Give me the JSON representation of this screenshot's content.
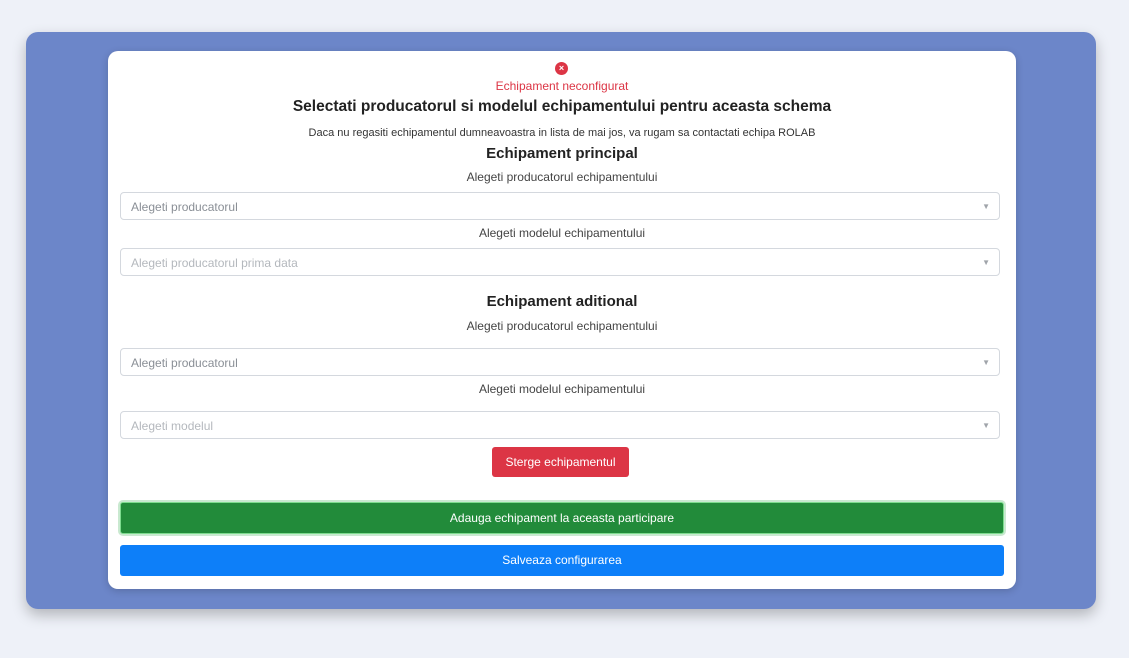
{
  "status": {
    "icon": "error-x-icon",
    "icon_glyph": "×",
    "text": "Echipament neconfigurat",
    "color": "#dc3545"
  },
  "header": {
    "title": "Selectati producatorul si modelul echipamentului pentru aceasta schema",
    "note": "Daca nu regasiti echipamentul dumneavoastra in lista de mai jos, va rugam sa contactati echipa ROLAB"
  },
  "principal": {
    "title": "Echipament principal",
    "producer_label": "Alegeti producatorul echipamentului",
    "producer_placeholder": "Alegeti producatorul",
    "model_label": "Alegeti modelul echipamentului",
    "model_placeholder": "Alegeti producatorul prima data"
  },
  "aditional": {
    "title": "Echipament aditional",
    "producer_label": "Alegeti producatorul echipamentului",
    "producer_placeholder": "Alegeti producatorul",
    "model_label": "Alegeti modelul echipamentului",
    "model_placeholder": "Alegeti modelul"
  },
  "actions": {
    "delete_label": "Sterge echipamentul",
    "add_label": "Adauga echipament la aceasta participare",
    "save_label": "Salveaza configurarea"
  },
  "colors": {
    "outer_panel": "#6c86c9",
    "danger": "#dc3545",
    "success": "#228b3a",
    "primary": "#0d7ff9"
  }
}
